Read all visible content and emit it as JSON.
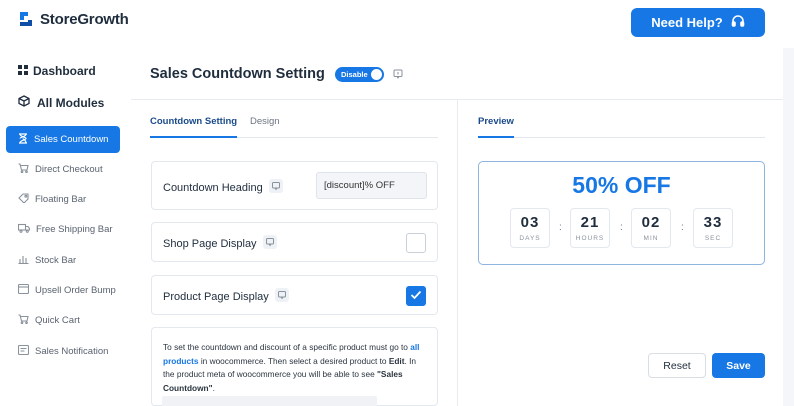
{
  "brand": {
    "name": "StoreGrowth",
    "color": "#1677e5"
  },
  "header": {
    "help_label": "Need Help?",
    "help_icon": "headset-icon"
  },
  "sidebar": {
    "top_items": [
      {
        "label": "Dashboard",
        "icon": "grid-icon"
      },
      {
        "label": "All Modules",
        "icon": "cube-icon"
      }
    ],
    "items": [
      {
        "label": "Sales Countdown",
        "icon": "hourglass-icon",
        "active": true
      },
      {
        "label": "Direct Checkout",
        "icon": "cart-icon"
      },
      {
        "label": "Floating Bar",
        "icon": "tag-icon"
      },
      {
        "label": "Free Shipping Bar",
        "icon": "truck-icon"
      },
      {
        "label": "Stock Bar",
        "icon": "bar-chart-icon"
      },
      {
        "label": "Upsell Order Bump",
        "icon": "browser-icon"
      },
      {
        "label": "Quick Cart",
        "icon": "cart-icon"
      },
      {
        "label": "Sales Notification",
        "icon": "notification-icon"
      }
    ]
  },
  "page": {
    "title": "Sales Countdown Setting",
    "toggle_label": "Disable",
    "tabs": [
      "Countdown Setting",
      "Design"
    ],
    "active_tab": "Countdown Setting"
  },
  "settings": {
    "countdown_heading": {
      "label": "Countdown Heading",
      "value": "[discount]% OFF"
    },
    "shop_page_display": {
      "label": "Shop Page Display",
      "checked": false
    },
    "product_page_display": {
      "label": "Product Page Display",
      "checked": true
    }
  },
  "note": {
    "text_1": "To set the countdown and discount of a specific product must go to",
    "link": "all products",
    "text_2": "in woocommerce. Then select a desired product to",
    "edit": "Edit",
    "text_3": ". In the product meta of woocommerce you will be able to see",
    "quote": "\"Sales Countdown\"",
    "text_4": "."
  },
  "preview": {
    "tab_label": "Preview",
    "heading": "50% OFF",
    "timer": [
      {
        "value": "03",
        "label": "DAYS"
      },
      {
        "value": "21",
        "label": "HOURS"
      },
      {
        "value": "02",
        "label": "MIN"
      },
      {
        "value": "33",
        "label": "SEC"
      }
    ],
    "separator": ":"
  },
  "actions": {
    "reset_label": "Reset",
    "save_label": "Save"
  }
}
